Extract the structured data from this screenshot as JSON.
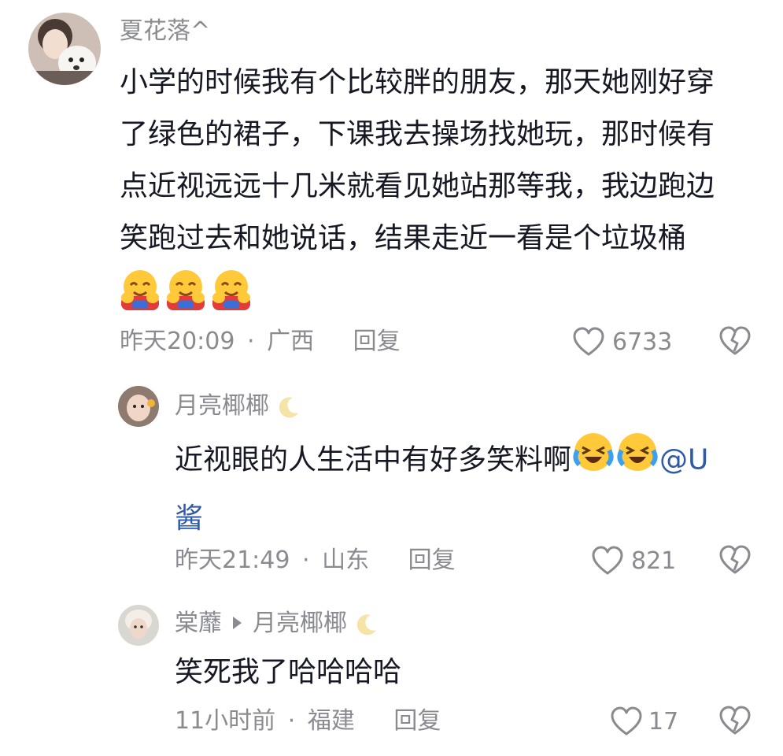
{
  "comments": [
    {
      "username": "夏花落^",
      "text_lines": [
        "小学的时候我有个比较胖的朋友，那天她刚好穿",
        "了绿色的裙子，下课我去操场找她玩，那时候有",
        "点近视远远十几米就看见她站那等我，我边跑边",
        "笑跑过去和她说话，结果走近一看是个垃圾桶"
      ],
      "emoji_icons": [
        "hugging-face-icon",
        "hugging-face-icon",
        "hugging-face-icon"
      ],
      "time": "昨天20:09",
      "separator": "·",
      "location": "广西",
      "reply_label": "回复",
      "likes": "6733"
    },
    {
      "username": "月亮椰椰",
      "text_line1": "近视眼的人生活中有好多笑料啊",
      "mention_part1": "@U",
      "mention_part2": "酱",
      "emoji_icons": [
        "loudly-crying-laughing-icon",
        "loudly-crying-laughing-icon"
      ],
      "time": "昨天21:49",
      "separator": "·",
      "location": "山东",
      "reply_label": "回复",
      "likes": "821"
    },
    {
      "username": "棠蘼",
      "reply_to": "月亮椰椰",
      "text": "笑死我了哈哈哈哈",
      "time": "11小时前",
      "separator": "·",
      "location": "福建",
      "reply_label": "回复",
      "likes": "17"
    }
  ]
}
